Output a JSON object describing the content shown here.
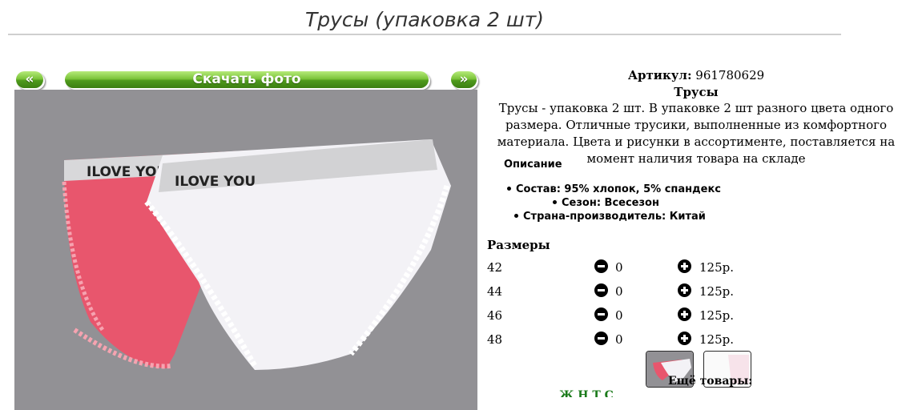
{
  "page": {
    "title": "Трусы (упаковка 2 шт)"
  },
  "gallery": {
    "prev_label": "«",
    "download_label": "Скачать фото",
    "next_label": "»",
    "print_text_1": "ILOVE YOU",
    "print_text_2": "ILOVE YOU"
  },
  "product": {
    "article_label": "Артикул:",
    "article_value": "961780629",
    "name": "Трусы",
    "description": "Трусы - упаковка 2 шт. В упаковке 2 шт разного цвета одного размера. Отличные трусики, выполненные из комфортного материала. Цвета и рисунки в ассортименте, поставляется на момент наличия товара на складе",
    "desc_heading": "Описание",
    "specs": [
      "Состав: 95% хлопок, 5% спандекс",
      "Сезон: Всесезон",
      "Страна-производитель: Китай"
    ]
  },
  "sizes": {
    "heading": "Размеры",
    "rows": [
      {
        "size": "42",
        "qty": "0",
        "price": "125р."
      },
      {
        "size": "44",
        "qty": "0",
        "price": "125р."
      },
      {
        "size": "46",
        "qty": "0",
        "price": "125р."
      },
      {
        "size": "48",
        "qty": "0",
        "price": "125р."
      }
    ]
  },
  "more": {
    "heading": "Ещё товары:",
    "links_text": "Ж                    Н                         Т       С"
  },
  "colors": {
    "green_button": "#5aa822",
    "photo_bg": "#929195",
    "pink": "#e8566d",
    "white_item": "#f3f2f6",
    "link_green": "#1a7a1a"
  }
}
